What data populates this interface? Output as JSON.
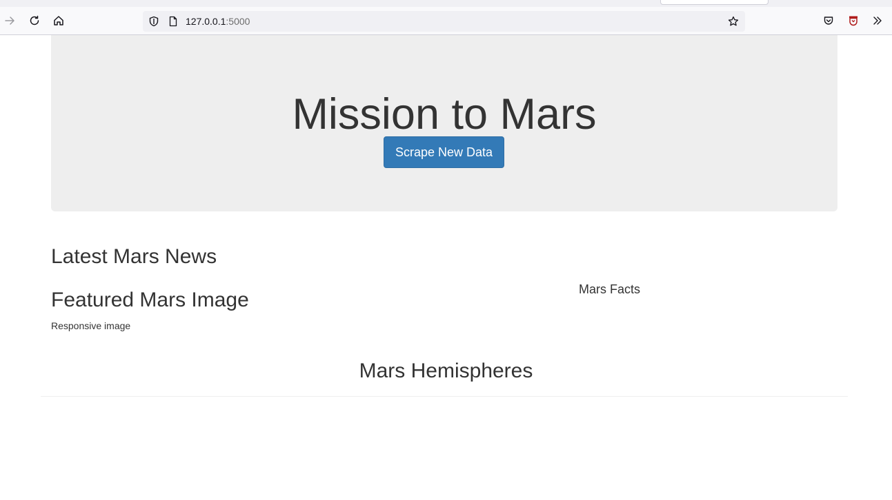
{
  "browser": {
    "url_host": "127.0.0.1",
    "url_port": ":5000",
    "icons": {
      "forward": "arrow-right-icon",
      "reload": "reload-icon",
      "home": "home-icon",
      "tracking": "shield-icon",
      "page": "page-icon",
      "bookmark": "star-icon",
      "pocket": "pocket-icon",
      "extension": "extension-icon",
      "overflow": "chevron-double-right-icon"
    }
  },
  "page": {
    "title": "Mission to Mars",
    "scrape_button": "Scrape New Data",
    "news_heading": "Latest Mars News",
    "featured_heading": "Featured Mars Image",
    "featured_image_alt": "Responsive image",
    "facts_heading": "Mars Facts",
    "hemispheres_heading": "Mars Hemispheres"
  },
  "colors": {
    "primary_button": "#337ab7",
    "jumbotron_bg": "#eeeeee",
    "text": "#333333"
  }
}
